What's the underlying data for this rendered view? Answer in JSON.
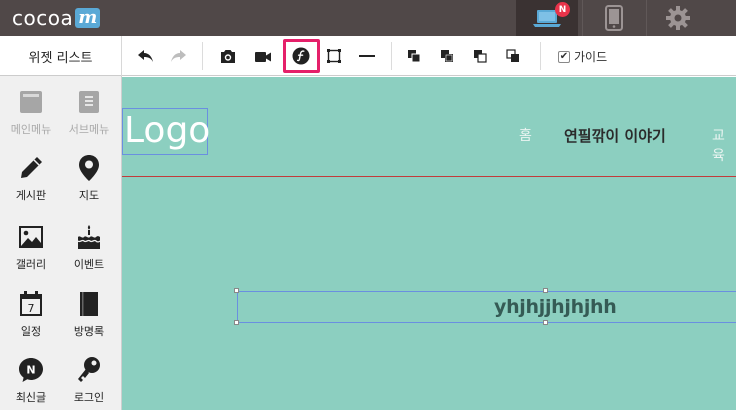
{
  "app": {
    "logo_text": "cocoa",
    "logo_mark": "m",
    "notification_badge": "N"
  },
  "toolbar": {
    "panel_title": "위젯 리스트",
    "guide_label": "가이드",
    "guide_checked": true,
    "buttons": [
      "undo-icon",
      "redo-icon",
      "camera-icon",
      "video-icon",
      "flash-icon",
      "box-select-icon",
      "line-icon",
      "bring-front-icon",
      "bring-forward-icon",
      "send-backward-icon",
      "send-back-icon"
    ],
    "highlight_color": "#e5206a"
  },
  "sidebar": {
    "items": [
      {
        "label": "메인메뉴",
        "icon": "main-menu-icon",
        "enabled": false
      },
      {
        "label": "서브메뉴",
        "icon": "sub-menu-icon",
        "enabled": false
      },
      {
        "label": "게시판",
        "icon": "pencil-icon",
        "enabled": true
      },
      {
        "label": "지도",
        "icon": "map-pin-icon",
        "enabled": true
      },
      {
        "label": "갤러리",
        "icon": "image-icon",
        "enabled": true
      },
      {
        "label": "이벤트",
        "icon": "cake-icon",
        "enabled": true
      },
      {
        "label": "일정",
        "icon": "calendar-icon",
        "enabled": true
      },
      {
        "label": "방명록",
        "icon": "book-icon",
        "enabled": true
      },
      {
        "label": "최신글",
        "icon": "new-badge-icon",
        "enabled": true
      },
      {
        "label": "로그인",
        "icon": "key-icon",
        "enabled": true
      }
    ],
    "calendar_day": "7",
    "new_badge_letter": "N"
  },
  "canvas": {
    "background": "#8ccfc0",
    "site_logo": "Logo",
    "nav": [
      "홈",
      "연필깎이 이야기",
      "교육"
    ],
    "text_widget": "yhjhjjhjhjhh",
    "divider_color": "#c23b3b"
  }
}
